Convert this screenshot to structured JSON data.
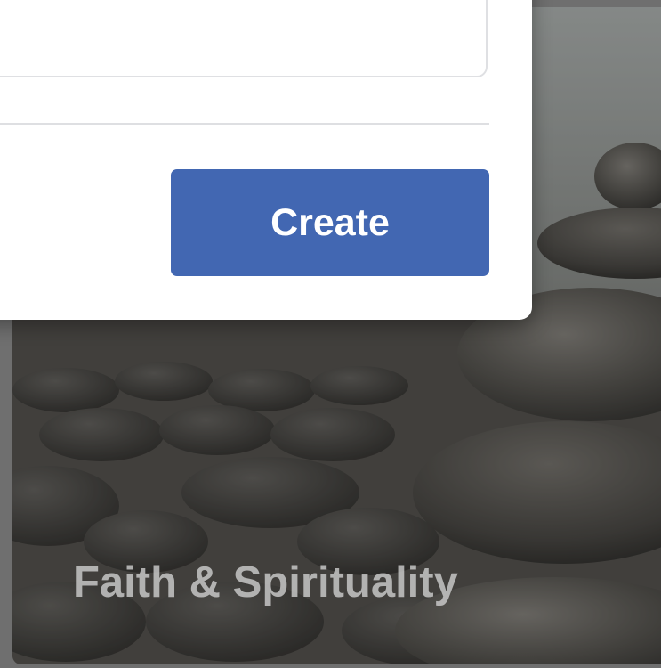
{
  "modal": {
    "create_label": "Create",
    "primary_color": "#4267b2"
  },
  "category_card": {
    "title": "Faith & Spirituality",
    "image": "stacked-stones-photo"
  }
}
